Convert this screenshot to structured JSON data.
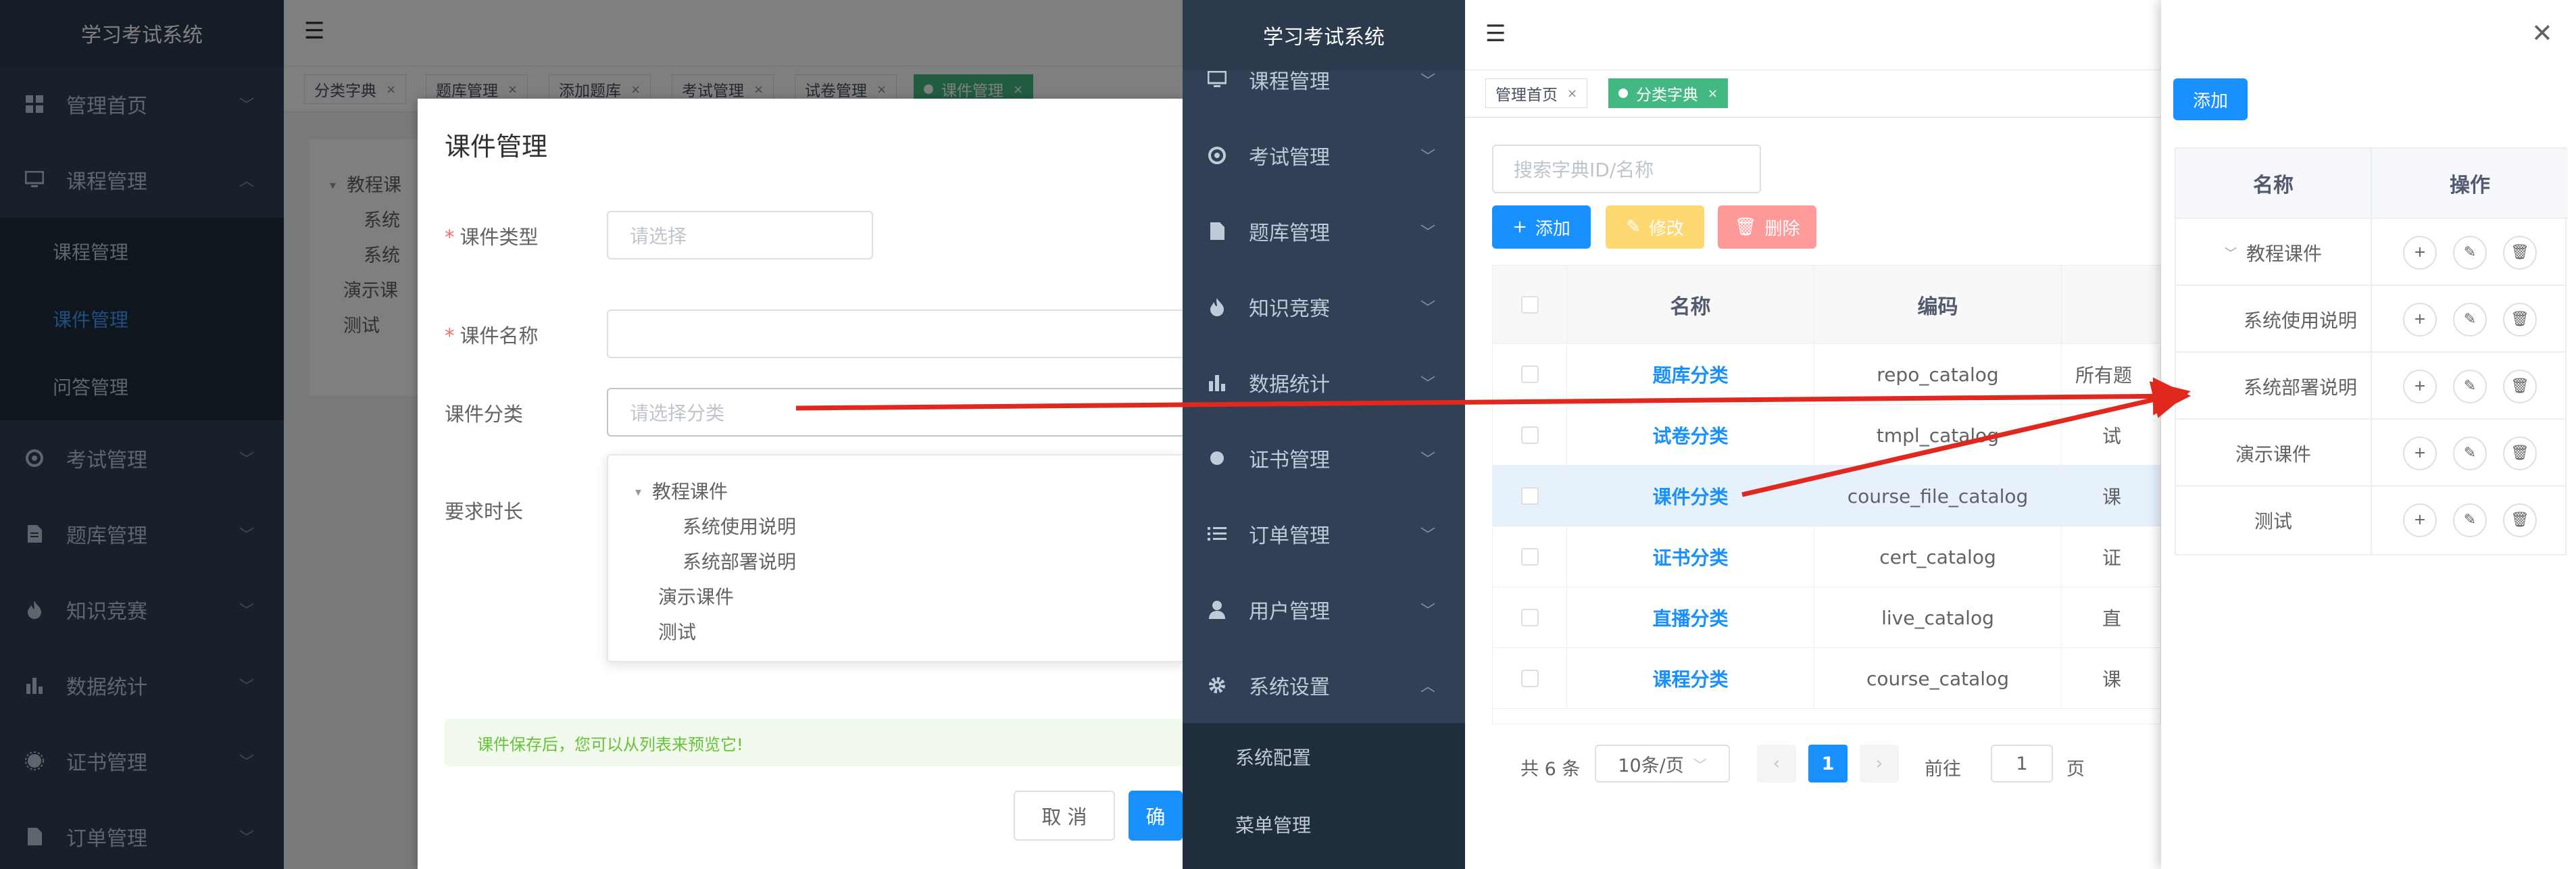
{
  "left_window": {
    "app_title": "学习考试系统",
    "sidebar": {
      "items": [
        {
          "label": "管理首页",
          "icon": "dashboard-icon"
        },
        {
          "label": "课程管理",
          "icon": "monitor-icon",
          "expanded": true
        },
        {
          "label": "考试管理",
          "icon": "exam-icon"
        },
        {
          "label": "题库管理",
          "icon": "document-icon"
        },
        {
          "label": "知识竞赛",
          "icon": "fire-icon"
        },
        {
          "label": "数据统计",
          "icon": "bar-chart-icon"
        },
        {
          "label": "证书管理",
          "icon": "certificate-icon"
        },
        {
          "label": "订单管理",
          "icon": "list-icon"
        }
      ],
      "subitems": [
        {
          "label": "课程管理"
        },
        {
          "label": "课件管理",
          "active": true
        },
        {
          "label": "问答管理"
        }
      ]
    },
    "tags": [
      {
        "label": "分类字典"
      },
      {
        "label": "题库管理"
      },
      {
        "label": "添加题库"
      },
      {
        "label": "考试管理"
      },
      {
        "label": "试卷管理"
      },
      {
        "label": "课件管理",
        "active": true
      }
    ],
    "background_tree": {
      "n1": "教程课",
      "n2": "系统",
      "n3": "系统",
      "n4": "演示课",
      "n5": "测试"
    },
    "dialog": {
      "title": "课件管理",
      "type_label": "课件类型",
      "type_placeholder": "请选择",
      "name_label": "课件名称",
      "name_value": "",
      "category_label": "课件分类",
      "category_placeholder": "请选择分类",
      "duration_label": "要求时长",
      "tree": [
        {
          "label": "教程课件",
          "level": 0,
          "expanded": true
        },
        {
          "label": "系统使用说明",
          "level": 1
        },
        {
          "label": "系统部署说明",
          "level": 1
        },
        {
          "label": "演示课件",
          "level": 0
        },
        {
          "label": "测试",
          "level": 0
        }
      ],
      "notice": "课件保存后，您可以从列表来预览它!",
      "cancel_label": "取 消",
      "confirm_label": "确"
    }
  },
  "second_window": {
    "app_title": "学习考试系统",
    "sidebar": {
      "items": [
        {
          "label": "课程管理",
          "icon": "monitor-icon"
        },
        {
          "label": "考试管理",
          "icon": "exam-icon"
        },
        {
          "label": "题库管理",
          "icon": "document-icon"
        },
        {
          "label": "知识竞赛",
          "icon": "fire-icon"
        },
        {
          "label": "数据统计",
          "icon": "bar-chart-icon"
        },
        {
          "label": "证书管理",
          "icon": "certificate-icon"
        },
        {
          "label": "订单管理",
          "icon": "list-icon"
        },
        {
          "label": "用户管理",
          "icon": "user-icon"
        },
        {
          "label": "系统设置",
          "icon": "gear-icon",
          "expanded": true
        }
      ],
      "subitems": [
        {
          "label": "系统配置"
        },
        {
          "label": "菜单管理"
        }
      ]
    },
    "tags": [
      {
        "label": "管理首页"
      },
      {
        "label": "分类字典",
        "active": true
      }
    ],
    "search_placeholder": "搜索字典ID/名称",
    "toolbar": {
      "add": "添加",
      "edit": "修改",
      "delete": "删除",
      "colors": {
        "add": "#1890ff",
        "edit": "#ffba00",
        "delete": "#ff4949"
      }
    },
    "table": {
      "headers": [
        "名称",
        "编码"
      ],
      "rows": [
        {
          "name": "题库分类",
          "code": "repo_catalog",
          "extra": "所有题"
        },
        {
          "name": "试卷分类",
          "code": "tmpl_catalog",
          "extra": "试"
        },
        {
          "name": "课件分类",
          "code": "course_file_catalog",
          "extra": "课",
          "highlight": true
        },
        {
          "name": "证书分类",
          "code": "cert_catalog",
          "extra": "证"
        },
        {
          "name": "直播分类",
          "code": "live_catalog",
          "extra": "直"
        },
        {
          "name": "课程分类",
          "code": "course_catalog",
          "extra": "课"
        }
      ]
    },
    "pagination": {
      "total": "共 6 条",
      "page_size": "10条/页",
      "current": "1",
      "goto_label": "前往",
      "goto_value": "1",
      "page_suffix": "页"
    }
  },
  "drawer": {
    "add_label": "添加",
    "headers": [
      "名称",
      "操作"
    ],
    "rows": [
      {
        "label": "教程课件",
        "expanded": true
      },
      {
        "label": "系统使用说明"
      },
      {
        "label": "系统部署说明"
      },
      {
        "label": "演示课件"
      },
      {
        "label": "测试"
      }
    ]
  },
  "colors": {
    "sidebar_bg": "#304156",
    "primary": "#1890ff",
    "tag_active": "#42b983",
    "annotation_arrow": "#e0281e"
  }
}
